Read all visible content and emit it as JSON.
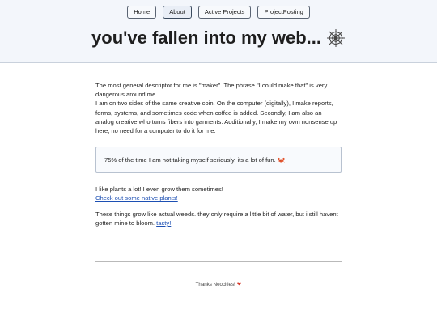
{
  "nav": {
    "items": [
      {
        "label": "Home"
      },
      {
        "label": "About"
      },
      {
        "label": "Active Projects"
      },
      {
        "label": "ProjectPosting"
      }
    ]
  },
  "header": {
    "title": "you've fallen into my web...",
    "title_icon": "spider-web-icon"
  },
  "main": {
    "intro_1": "The most general descriptor for me is \"maker\". The phrase \"I could make that\" is very dangerous around me.",
    "intro_2": "I am on two sides of the same creative coin. On the computer (digitally), I make reports, forms, systems, and sometimes code when coffee is added. Secondly, I am also an analog creative who turns fibers into garments.   Additionally, I make my own nonsense up here, no need for a computer to do it for me.",
    "callout": "75% of the time I am not taking myself seriously. its a lot of fun.",
    "callout_icon": "crab-icon",
    "plants_text": "I like plants a lot! I even grow them sometimes!",
    "plants_link": "Check out some native plants!",
    "weeds_text": "These things grow like actual weeds. they only require a little bit of water, but i still havent gotten mine to bloom.",
    "weeds_link": "tasty!"
  },
  "footer": {
    "text": "Thanks Neocities!",
    "icon": "heart-icon",
    "heart_glyph": "❤"
  },
  "colors": {
    "header_bg": "#f3f6fb",
    "link": "#1c4fb3",
    "heart": "#d63a2c"
  }
}
